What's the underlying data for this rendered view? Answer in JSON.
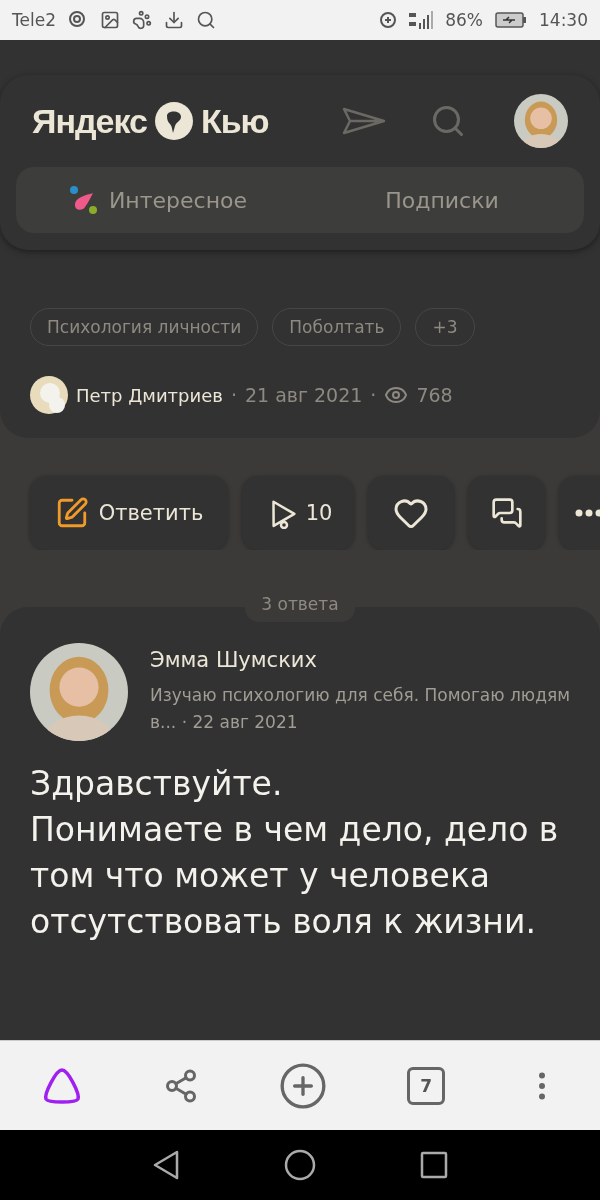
{
  "status_bar": {
    "carrier": "Tele2",
    "battery": "86%",
    "time": "14:30"
  },
  "header": {
    "logo_left": "Яндекс",
    "logo_right": "Кью",
    "tabs": [
      {
        "label": "Интересное"
      },
      {
        "label": "Подписки"
      }
    ]
  },
  "separator": "·",
  "question": {
    "tags": [
      "Психология личности",
      "Поболтать",
      "+3"
    ],
    "author": "Петр Дмитриев",
    "date": "21 авг 2021",
    "views": "768"
  },
  "actions": {
    "reply": "Ответить",
    "upvotes": "10"
  },
  "answers": {
    "count": "3 ответа",
    "items": [
      {
        "author": "Эмма Шумских",
        "bio": "Изучаю психологию для себя. Помогаю людям в...",
        "date": "22 авг 2021",
        "paragraphs": [
          "Здравствуйте.",
          "Понимаете в чем дело, дело в том что может у человека отсутствовать воля к жизни."
        ]
      }
    ]
  },
  "browser_bar": {
    "tabs_count": "7"
  }
}
